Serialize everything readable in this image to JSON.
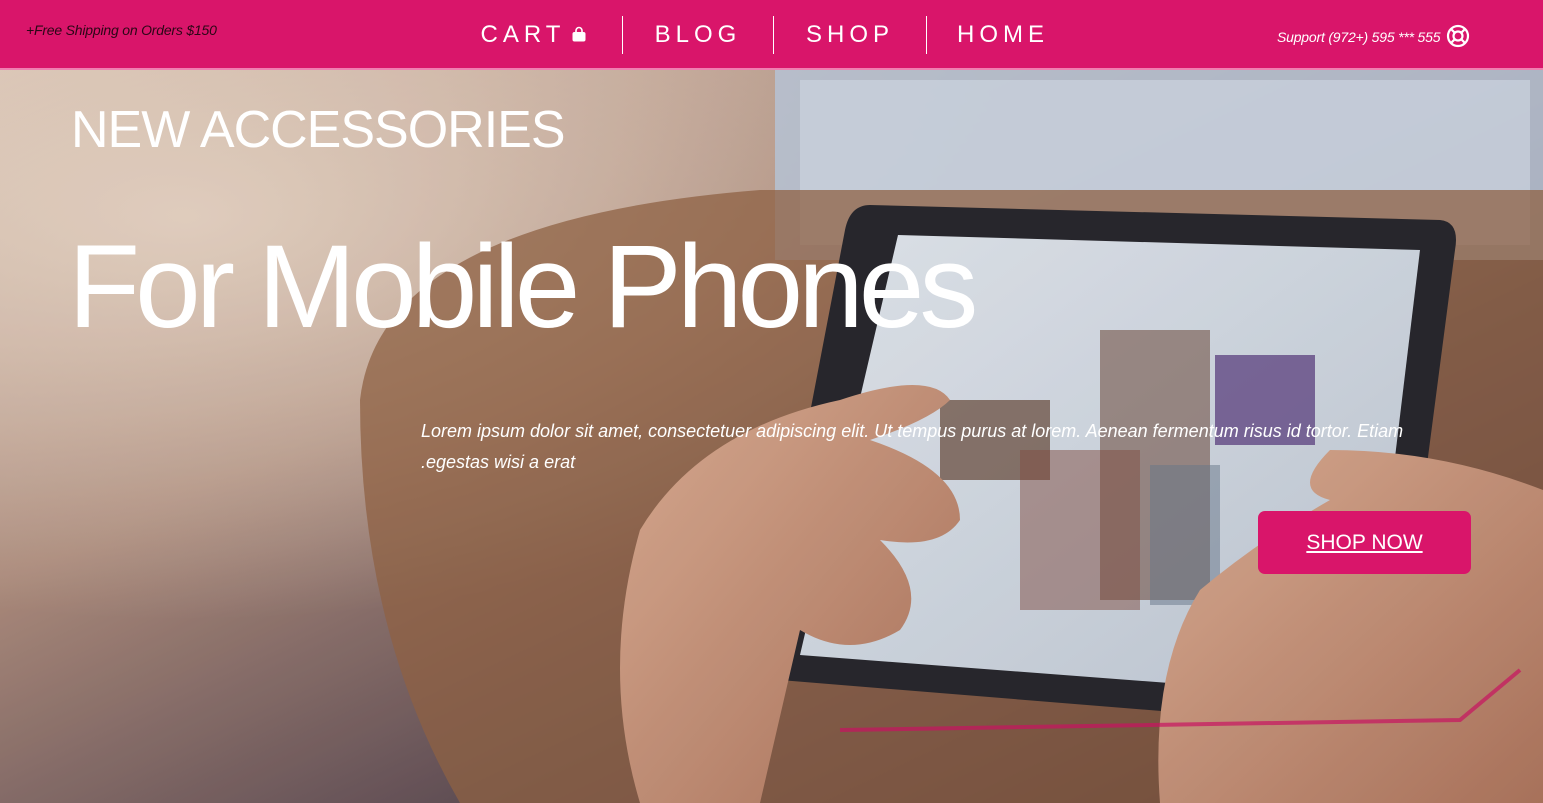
{
  "header": {
    "promo": "+Free Shipping on Orders $150",
    "nav": {
      "cart": "CART",
      "blog": "BLOG",
      "shop": "SHOP",
      "home": "HOME"
    },
    "support": "Support (972+) 595 *** 555",
    "icons": {
      "cart": "shopping-bag-icon",
      "support": "lifebuoy-icon"
    }
  },
  "hero": {
    "eyebrow": "NEW ACCESSORIES",
    "headline": "For Mobile Phones",
    "blurb": "Lorem ipsum dolor sit amet, consectetuer adipiscing elit. Ut tempus purus at lorem. Aenean fermentum risus id tortor. Etiam egestas wisi a erat.",
    "cta_label": "SHOP NOW"
  },
  "colors": {
    "brand": "#d9156a",
    "header_border": "#ef7fb0",
    "text_light": "#ffffff"
  }
}
